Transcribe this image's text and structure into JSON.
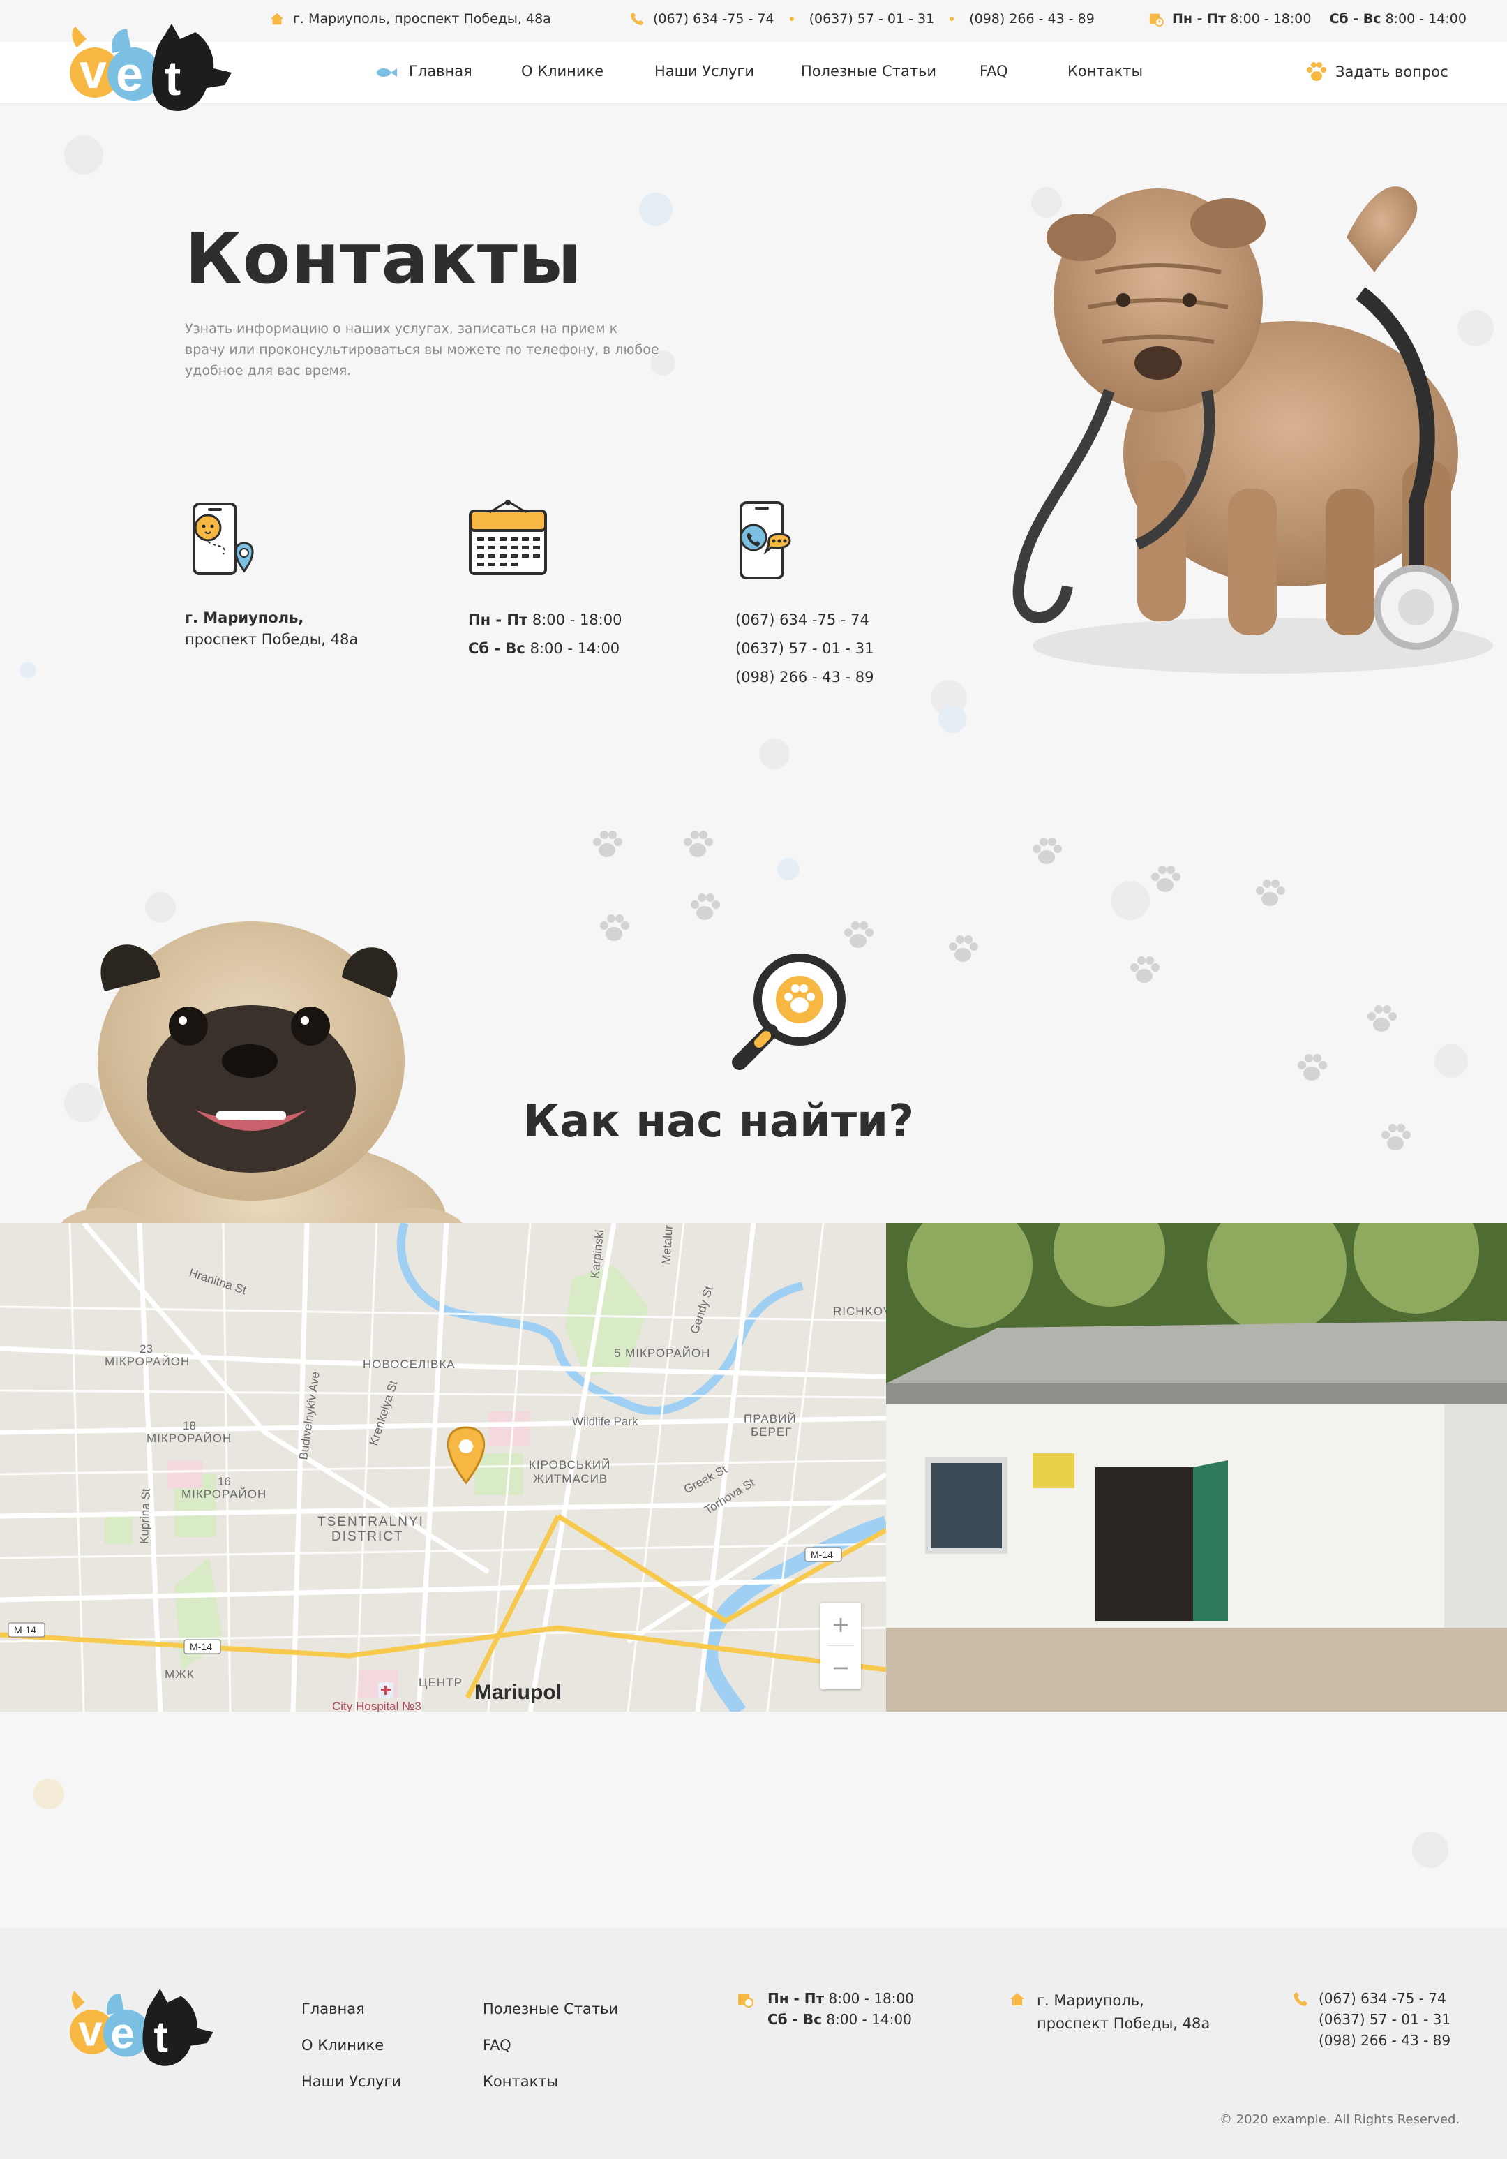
{
  "topbar": {
    "address": "г. Мариуполь, проспект Победы, 48а",
    "phones": [
      "(067) 634 -75 - 74",
      "(0637) 57 - 01 - 31",
      "(098) 266 - 43 - 89"
    ],
    "hours_weekday_label": "Пн - Пт",
    "hours_weekday": "8:00 - 18:00",
    "hours_weekend_label": "Сб - Вс",
    "hours_weekend": "8:00 - 14:00"
  },
  "brand": {
    "logo_letters": [
      "v",
      "e",
      "t"
    ],
    "colors": [
      "#f7b843",
      "#7bbfe3",
      "#1d1d1d"
    ]
  },
  "nav": {
    "items": [
      "Главная",
      "О Клинике",
      "Наши Услуги",
      "Полезные Статьи",
      "FAQ",
      "Контакты"
    ],
    "ask": "Задать вопрос"
  },
  "hero": {
    "title": "Контакты",
    "description": "Узнать информацию о наших услугах, записаться на прием к врачу или проконсультироваться вы можете по телефону, в любое удобное для вас время."
  },
  "info": {
    "address_line1": "г. Мариуполь,",
    "address_line2": "проспект Победы, 48а",
    "hours_weekday_label": "Пн - Пт",
    "hours_weekday": "8:00 - 18:00",
    "hours_weekend_label": "Сб - Вс",
    "hours_weekend": "8:00 - 14:00",
    "phones": [
      "(067) 634 -75 - 74",
      "(0637) 57 - 01 - 31",
      "(098) 266 - 43 - 89"
    ]
  },
  "find": {
    "title": "Как нас найти?"
  },
  "map": {
    "labels": {
      "hranitna": "Hranitna St",
      "mikro23_num": "23",
      "mikro23": "МІКРОРАЙОН",
      "novoselivka": "НОВОСЕЛІВКА",
      "mikro18_num": "18",
      "mikro18": "МІКРОРАЙОН",
      "mikro16_num": "16",
      "mikro16": "МІКРОРАЙОН",
      "budivelnykiv": "Budivelnykiv Ave",
      "krenkelya": "Krenkelya St",
      "kuprina": "Kuprina St",
      "tsentralnyi1": "TSENTRALNYI",
      "tsentralnyi2": "DISTRICT",
      "karpinski": "Karpinski",
      "metalur": "Metalur",
      "gendy": "Gendy St",
      "mikro5": "5 МІКРОРАЙОН",
      "wildlife": "Wildlife Park",
      "pravyi1": "ПРАВИЙ",
      "pravyi2": "БЕРЕГ",
      "kirovskyi1": "КІРОВСЬКИЙ",
      "kirovskyi2": "ЖИТМАСИВ",
      "greek": "Greek St",
      "torhova": "Torhova St",
      "richkov": "RICHKOV",
      "m14": "M-14",
      "mzhk": "МЖК",
      "tsentr": "ЦЕНТР",
      "mariupol": "Mariupol",
      "hospital": "City Hospital №3",
      "zoom_in": "+",
      "zoom_out": "−"
    }
  },
  "footer": {
    "col1": [
      "Главная",
      "О Клинике",
      "Наши Услуги"
    ],
    "col2": [
      "Полезные Статьи",
      "FAQ",
      "Контакты"
    ],
    "hours_weekday_label": "Пн - Пт",
    "hours_weekday": "8:00 - 18:00",
    "hours_weekend_label": "Сб - Вс",
    "hours_weekend": "8:00 - 14:00",
    "address_line1": "г. Мариуполь,",
    "address_line2": "проспект Победы, 48а",
    "phones": [
      "(067) 634 -75 - 74",
      "(0637) 57 - 01 - 31",
      "(098) 266 - 43 - 89"
    ],
    "copyright": "© 2020 example. All Rights Reserved."
  },
  "colors": {
    "accent": "#f7b843",
    "blue": "#7bbfe3",
    "text": "#2e2e2e",
    "muted": "#8b8b8b"
  }
}
